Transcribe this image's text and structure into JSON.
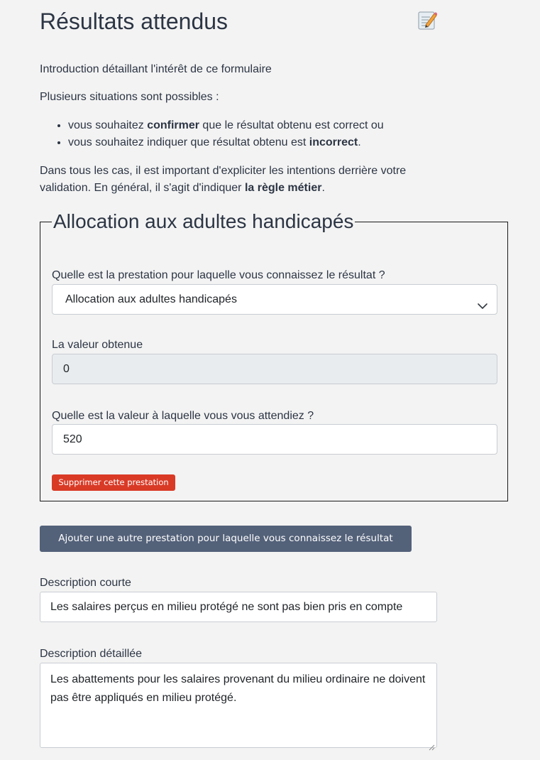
{
  "page": {
    "title": "Résultats attendus",
    "edit_icon": "memo-pencil-icon"
  },
  "intro": {
    "text": "Introduction détaillant l'intérêt de ce formulaire",
    "situations_text": "Plusieurs situations sont possibles :",
    "choices": [
      {
        "before": "vous souhaitez ",
        "bold": "confirmer",
        "after": " que le résultat obtenu est correct ou"
      },
      {
        "before": "vous souhaitez indiquer que résultat obtenu est ",
        "bold": "incorrect",
        "after": "."
      }
    ],
    "cases_before": "Dans tous les cas, il est important d'expliciter les intentions derrière votre validation. En général, il s'agit d'indiquer ",
    "cases_bold": "la règle métier",
    "cases_after": "."
  },
  "benefit": {
    "legend": "Allocation aux adultes handicapés",
    "prestation_label": "Quelle est la prestation pour laquelle vous connaissez le résultat ?",
    "prestation_selected": "Allocation aux adultes handicapés",
    "obtained_label": "La valeur obtenue",
    "obtained_value": "0",
    "expected_label": "Quelle est la valeur à laquelle vous vous attendiez ?",
    "expected_value": "520",
    "delete_label": "Supprimer cette prestation"
  },
  "actions": {
    "add_label": "Ajouter une autre prestation pour laquelle vous connaissez le résultat"
  },
  "description": {
    "short_label": "Description courte",
    "short_value": "Les salaires perçus en milieu protégé ne sont pas bien pris en compte",
    "long_label": "Description détaillée",
    "long_value": "Les abattements pour les salaires provenant du milieu ordinaire ne doivent pas être appliqués en milieu protégé."
  },
  "colors": {
    "background": "#f3f3f3",
    "text": "#2c3544",
    "danger": "#d93a26",
    "secondary": "#536179",
    "readonly_bg": "#e9ecef"
  }
}
